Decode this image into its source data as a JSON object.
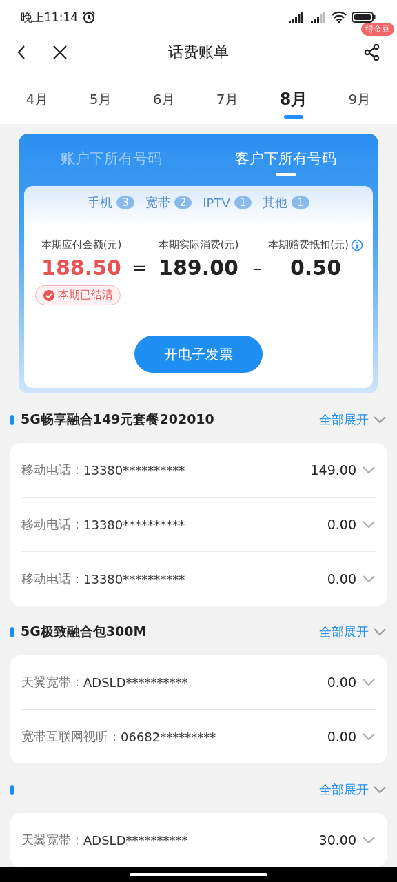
{
  "status_bar": {
    "time": "晚上11:14"
  },
  "header": {
    "title": "话费账单",
    "badge": "得金豆"
  },
  "months": [
    {
      "label": "4月",
      "selected": false
    },
    {
      "label": "5月",
      "selected": false
    },
    {
      "label": "6月",
      "selected": false
    },
    {
      "label": "7月",
      "selected": false
    },
    {
      "label": "8月",
      "selected": true
    },
    {
      "label": "9月",
      "selected": false
    }
  ],
  "account_tabs": [
    {
      "label": "账户下所有号码",
      "selected": false
    },
    {
      "label": "客户下所有号码",
      "selected": true
    }
  ],
  "categories": [
    {
      "label": "手机",
      "count": "3"
    },
    {
      "label": "宽带",
      "count": "2"
    },
    {
      "label": "IPTV",
      "count": "1"
    },
    {
      "label": "其他",
      "count": "1"
    }
  ],
  "summary": {
    "columns": [
      {
        "label": "本期应付金额(元)",
        "value": "188.50",
        "kind": "due"
      },
      {
        "label": "本期实际消费(元)",
        "value": "189.00",
        "kind": "plain"
      },
      {
        "label": "本期赠费抵扣(元)",
        "value": "0.50",
        "kind": "plain"
      }
    ],
    "operators": [
      "=",
      "–"
    ],
    "status": "本期已结清",
    "button": "开电子发票"
  },
  "packages": [
    {
      "name": "5G畅享融合149元套餐202010",
      "expand": "全部展开",
      "lines": [
        {
          "label": "移动电话：",
          "number": "13380**********",
          "amount": "149.00"
        },
        {
          "label": "移动电话：",
          "number": "13380**********",
          "amount": "0.00"
        },
        {
          "label": "移动电话：",
          "number": "13380**********",
          "amount": "0.00"
        }
      ]
    },
    {
      "name": "5G极致融合包300M",
      "expand": "全部展开",
      "lines": [
        {
          "label": "天翼宽带：",
          "number": "ADSLD**********",
          "amount": "0.00"
        },
        {
          "label": "宽带互联网视听：",
          "number": "06682*********",
          "amount": "0.00"
        }
      ]
    },
    {
      "expand": "全部展开",
      "lines": [
        {
          "label": "天翼宽带：",
          "number": "ADSLD**********",
          "amount": "30.00"
        }
      ]
    }
  ]
}
